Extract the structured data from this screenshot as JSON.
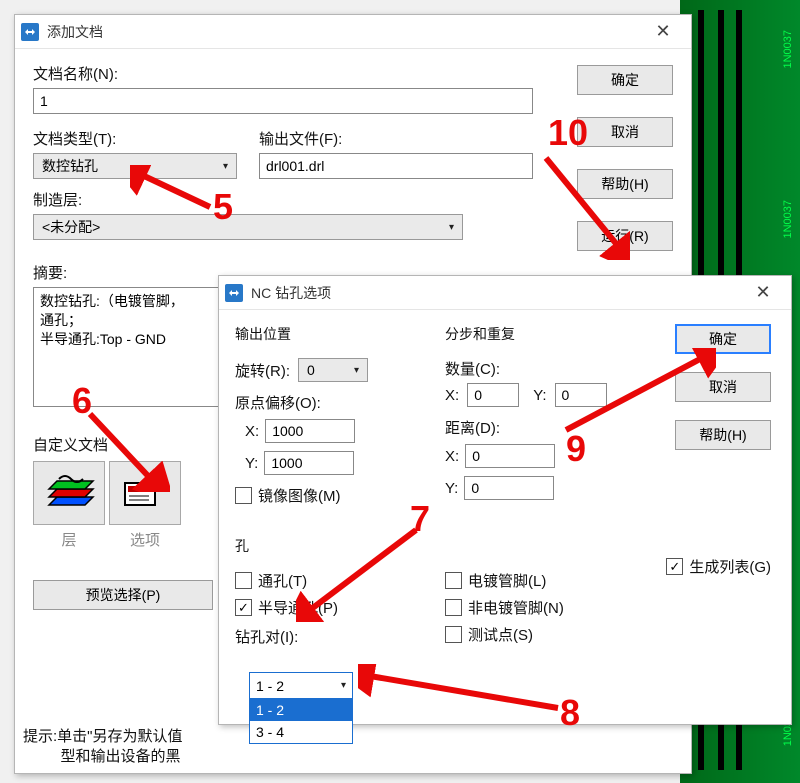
{
  "dialog1": {
    "title": "添加文档",
    "doc_name_label": "文档名称(N):",
    "doc_name_value": "1",
    "doc_type_label": "文档类型(T):",
    "doc_type_value": "数控钻孔",
    "output_file_label": "输出文件(F):",
    "output_file_value": "drl001.drl",
    "mfg_layer_label": "制造层:",
    "mfg_layer_value": "<未分配>",
    "summary_label": "摘要:",
    "summary_value": "数控钻孔:（电镀管脚，\n通孔；\n半导通孔:Top - GND",
    "custom_doc_label": "自定义文档",
    "layers_caption": "层",
    "options_caption": "选项",
    "preview_btn": "预览选择(P)",
    "ok_btn": "确定",
    "cancel_btn": "取消",
    "help_btn": "帮助(H)",
    "run_btn": "运行(R)",
    "hint": "提示:单击\"另存为默认值\n         型和输出设备的黑"
  },
  "dialog2": {
    "title": "NC 钻孔选项",
    "output_pos_label": "输出位置",
    "rotate_label": "旋转(R):",
    "rotate_value": "0",
    "origin_offset_label": "原点偏移(O):",
    "x_label": "X:",
    "y_label": "Y:",
    "origin_x": "1000",
    "origin_y": "1000",
    "mirror_label": "镜像图像(M)",
    "step_repeat_label": "分步和重复",
    "count_label": "数量(C):",
    "count_x": "0",
    "count_y": "0",
    "distance_label": "距离(D):",
    "dist_x": "0",
    "dist_y": "0",
    "holes_label": "孔",
    "through_label": "通孔(T)",
    "pvh_label": "半导通孔(P)",
    "plated_label": "电镀管脚(L)",
    "nonplated_label": "非电镀管脚(N)",
    "test_label": "测试点(S)",
    "drillpair_label": "钻孔对(I):",
    "drillpair_value": "1 - 2",
    "drillpair_opts": [
      "1 - 2",
      "3 - 4"
    ],
    "ok_btn": "确定",
    "cancel_btn": "取消",
    "help_btn": "帮助(H)",
    "genlist_label": "生成列表(G)"
  },
  "pcb_labels": [
    "1N0037",
    "1N0037",
    "1N03"
  ],
  "annotations": {
    "a5": "5",
    "a6": "6",
    "a7": "7",
    "a8": "8",
    "a9": "9",
    "a10": "10"
  }
}
